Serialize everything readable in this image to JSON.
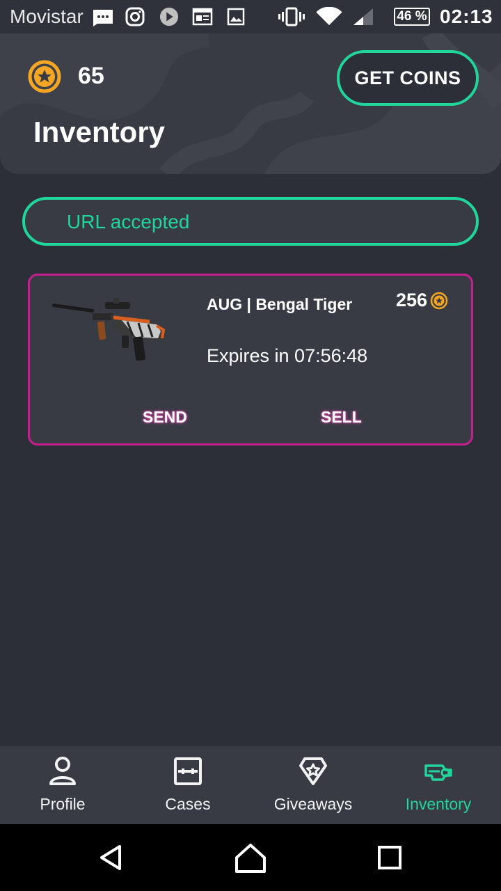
{
  "status_bar": {
    "carrier": "Movistar",
    "battery": "46 %",
    "time": "02:13",
    "icons": [
      "message-icon",
      "instagram-icon",
      "play-icon",
      "news-icon",
      "gallery-icon",
      "vibrate-icon",
      "wifi-icon",
      "signal-icon",
      "battery-icon"
    ]
  },
  "header": {
    "coins": "65",
    "get_coins_label": "GET COINS",
    "title": "Inventory"
  },
  "notice": {
    "text": "URL accepted"
  },
  "items": [
    {
      "name": "AUG | Bengal Tiger",
      "price": "256",
      "expires": "Expires in 07:56:48",
      "send_label": "SEND",
      "sell_label": "SELL"
    }
  ],
  "nav": {
    "items": [
      {
        "label": "Profile",
        "icon": "profile-icon"
      },
      {
        "label": "Cases",
        "icon": "cases-icon"
      },
      {
        "label": "Giveaways",
        "icon": "giveaways-icon"
      },
      {
        "label": "Inventory",
        "icon": "inventory-icon",
        "active": true
      }
    ]
  },
  "colors": {
    "accent": "#21d69b",
    "card_border": "#c71f8e",
    "coin": "#f5a623",
    "background": "#2c2f38"
  }
}
